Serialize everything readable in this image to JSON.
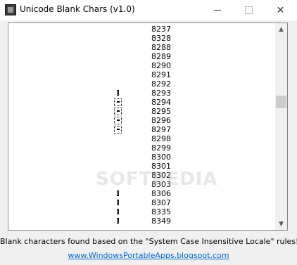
{
  "window": {
    "title": "Unicode Blank Chars (v1.0)",
    "close_glyph": "✕"
  },
  "list": {
    "rows": [
      {
        "code": "8237",
        "mark": "none"
      },
      {
        "code": "8328",
        "mark": "none"
      },
      {
        "code": "8288",
        "mark": "none"
      },
      {
        "code": "8289",
        "mark": "none"
      },
      {
        "code": "8290",
        "mark": "none"
      },
      {
        "code": "8291",
        "mark": "none"
      },
      {
        "code": "8292",
        "mark": "none"
      },
      {
        "code": "8293",
        "mark": "narrow-box"
      },
      {
        "code": "8294",
        "mark": "dotted-box"
      },
      {
        "code": "8295",
        "mark": "dotted-box"
      },
      {
        "code": "8296",
        "mark": "dotted-box"
      },
      {
        "code": "8297",
        "mark": "dotted-box"
      },
      {
        "code": "8298",
        "mark": "none"
      },
      {
        "code": "8299",
        "mark": "none"
      },
      {
        "code": "8300",
        "mark": "none"
      },
      {
        "code": "8301",
        "mark": "none"
      },
      {
        "code": "8302",
        "mark": "none"
      },
      {
        "code": "8303",
        "mark": "none"
      },
      {
        "code": "8306",
        "mark": "narrow-box"
      },
      {
        "code": "8307",
        "mark": "narrow-box"
      },
      {
        "code": "8335",
        "mark": "narrow-box"
      },
      {
        "code": "8349",
        "mark": "narrow-box"
      }
    ]
  },
  "scrollbar": {
    "up_arrow": "▲",
    "down_arrow": "▼"
  },
  "watermark": "SOFTPEDIA",
  "status_text": "Blank characters found based on the \"System Case Insensitive Locale\" rules!",
  "link_text": "www.WindowsPortableApps.blogspot.com"
}
